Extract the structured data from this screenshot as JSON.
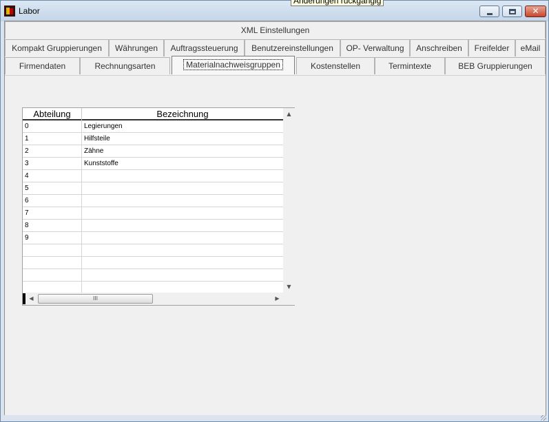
{
  "window": {
    "title": "Labor",
    "tooltip": "Änderungen rückgängig",
    "close_glyph": "✕"
  },
  "tabs": {
    "row0": [
      {
        "label": "XML Einstellungen"
      }
    ],
    "row1": [
      {
        "label": "Kompakt Gruppierungen"
      },
      {
        "label": "Währungen"
      },
      {
        "label": "Auftragssteuerung"
      },
      {
        "label": "Benutzereinstellungen"
      },
      {
        "label": "OP- Verwaltung"
      },
      {
        "label": "Anschreiben"
      },
      {
        "label": "Freifelder"
      },
      {
        "label": "eMail"
      }
    ],
    "row2": [
      {
        "label": "Firmendaten"
      },
      {
        "label": "Rechnungsarten"
      },
      {
        "label": "Materialnachweisgruppen"
      },
      {
        "label": "Kostenstellen"
      },
      {
        "label": "Termintexte"
      },
      {
        "label": "BEB Gruppierungen"
      }
    ],
    "active": "Materialnachweisgruppen"
  },
  "grid": {
    "columns": [
      "Abteilung",
      "Bezeichnung"
    ],
    "rows": [
      [
        "0",
        "Legierungen"
      ],
      [
        "1",
        "Hilfsteile"
      ],
      [
        "2",
        "Zähne"
      ],
      [
        "3",
        "Kunststoffe"
      ],
      [
        "4",
        ""
      ],
      [
        "5",
        ""
      ],
      [
        "6",
        ""
      ],
      [
        "7",
        ""
      ],
      [
        "8",
        ""
      ],
      [
        "9",
        ""
      ],
      [
        "",
        ""
      ],
      [
        "",
        ""
      ],
      [
        "",
        ""
      ],
      [
        "",
        ""
      ]
    ],
    "scroll_thumb_glyph": "III"
  },
  "icons": {
    "app": "app-icon",
    "minimize": "minimize-icon",
    "maximize": "maximize-icon",
    "close": "close-icon"
  }
}
